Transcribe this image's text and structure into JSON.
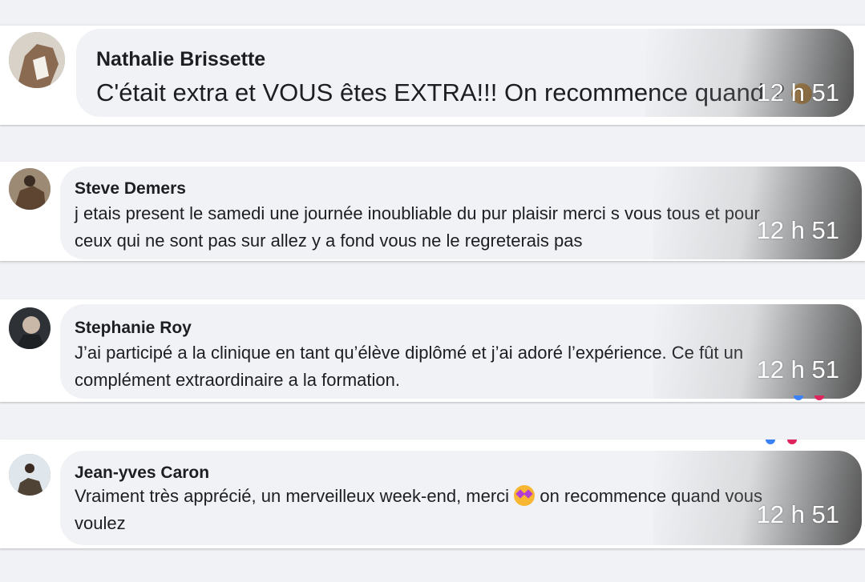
{
  "comments": [
    {
      "author": "Nathalie Brissette",
      "text": "C'était extra et VOUS êtes EXTRA!!! On recommence quand ?",
      "time": "12 h 51"
    },
    {
      "author": "Steve Demers",
      "text_line1": "j etais present le samedi une journée inoubliable du pur plaisir merci s vous tous et pour",
      "text_line2": "ceux qui ne sont pas sur allez y a fond vous ne le regreterais pas",
      "time": "12 h 51"
    },
    {
      "author": "Stephanie Roy",
      "text_line1": "J’ai participé a la clinique en tant qu’élève diplômé et j’ai adoré l’expérience. Ce fût un",
      "text_line2": "complément extraordinaire a la formation.",
      "time": "12 h 51"
    },
    {
      "author": "Jean-yves Caron",
      "text_line1_before": "Vraiment très apprécié, un merveilleux week-end, merci",
      "text_line1_after": "on recommence quand vous",
      "text_line2": "voulez",
      "time": "12 h 51"
    }
  ],
  "colors": {
    "bubble": "#f0f2f5",
    "card": "#ffffff",
    "background": "#e9ebee",
    "text": "#1c1e21"
  },
  "icons": {
    "emoji_1": "smiley-face-icon",
    "emoji_4": "star-struck-face-icon"
  }
}
